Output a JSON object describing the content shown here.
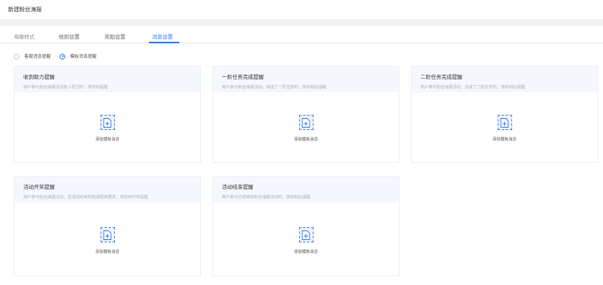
{
  "header": {
    "title": "新建粉丝海报"
  },
  "tabs": [
    {
      "label": "海报样式"
    },
    {
      "label": "规则设置"
    },
    {
      "label": "奖励设置"
    },
    {
      "label": "消息设置"
    }
  ],
  "radios": [
    {
      "label": "客服消息提醒",
      "checked": false
    },
    {
      "label": "模板消息提醒",
      "checked": true
    }
  ],
  "cards": [
    {
      "title": "收到助力提醒",
      "desc": "用户参与粉丝海报活动有人助力时，将收到提醒",
      "add_label": "添加模板消息"
    },
    {
      "title": "一阶任务完成提醒",
      "desc": "用户参与粉丝海报活动，完成了一阶任务时，将收到此提醒",
      "add_label": "添加模板消息"
    },
    {
      "title": "二阶任务完成提醒",
      "desc": "用户参与粉丝海报活动，完成了二阶任务时，将收到此提醒",
      "add_label": "添加模板消息"
    },
    {
      "title": "活动开奖提醒",
      "desc": "用户参与粉丝海报活动，在活动结束时完成配奖要求，将收到开奖提醒",
      "add_label": "添加模板消息"
    },
    {
      "title": "活动结束提醒",
      "desc": "用户参与已结束的粉丝海报活动时，将收到此提醒",
      "add_label": "添加模板消息"
    }
  ],
  "colors": {
    "accent": "#2f7cf6",
    "card_header_bg": "#f4f7fd",
    "page_bg": "#f0f2f5"
  },
  "icons": {
    "add": "add-document-icon"
  }
}
